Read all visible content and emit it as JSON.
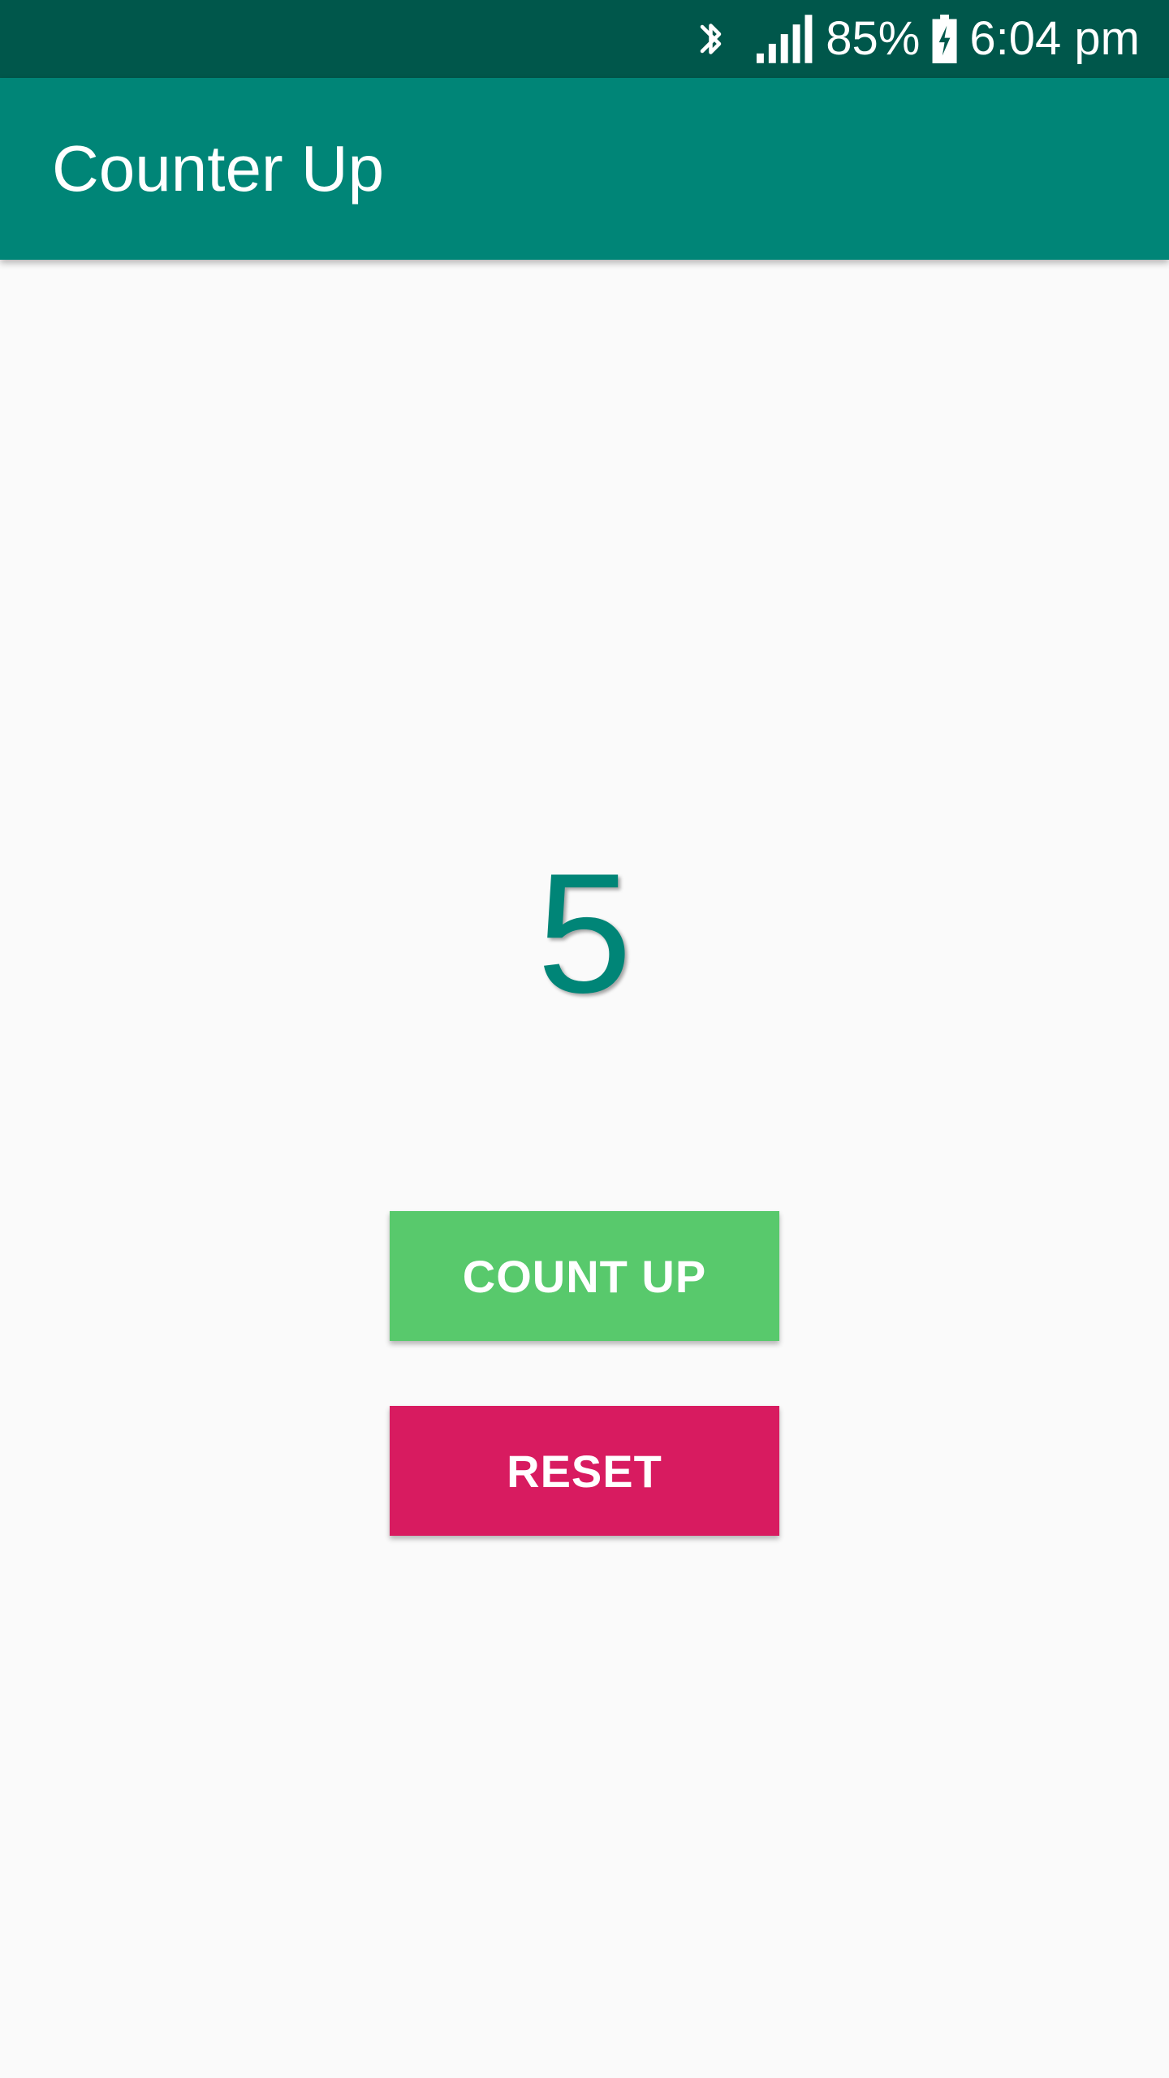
{
  "status_bar": {
    "icons": [
      "bluetooth-icon",
      "signal-icon",
      "battery-charging-icon"
    ],
    "battery_percent": "85%",
    "time": "6:04 pm"
  },
  "app_bar": {
    "title": "Counter Up"
  },
  "main": {
    "counter_value": "5",
    "count_up_label": "COUNT UP",
    "reset_label": "RESET"
  },
  "colors": {
    "status_bar": "#00574b",
    "primary": "#008577",
    "background": "#fafafa",
    "count_up_button": "#58c96c",
    "reset_button": "#d81b60"
  }
}
